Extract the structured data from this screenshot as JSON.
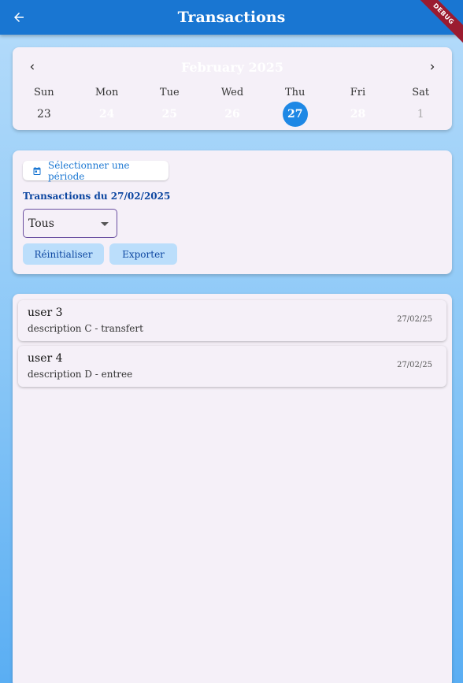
{
  "appbar": {
    "title": "Transactions",
    "debug_label": "DEBUG"
  },
  "calendar": {
    "month_label": "February 2025",
    "weekdays": [
      "Sun",
      "Mon",
      "Tue",
      "Wed",
      "Thu",
      "Fri",
      "Sat"
    ],
    "days": [
      "23",
      "24",
      "25",
      "26",
      "27",
      "28",
      "1"
    ],
    "selected_day": "27"
  },
  "filter": {
    "period_button_label": "Sélectionner une période",
    "range_label": "Transactions du 27/02/2025",
    "type_select_value": "Tous",
    "reset_label": "Réinitialiser",
    "export_label": "Exporter"
  },
  "transactions": [
    {
      "user": "user 3",
      "description": "description C - transfert",
      "date": "27/02/25"
    },
    {
      "user": "user 4",
      "description": "description D - entree",
      "date": "27/02/25"
    }
  ],
  "colors": {
    "primary": "#1976d2",
    "selected_day": "#1e88e5",
    "card_bg": "#f5f0f8",
    "pill_bg": "#bbdefb"
  }
}
